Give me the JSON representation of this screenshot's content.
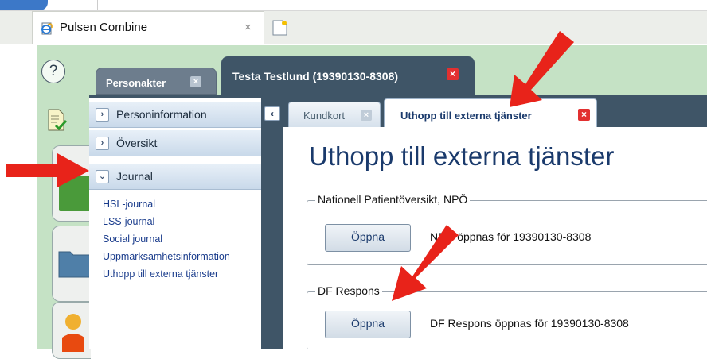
{
  "browser": {
    "tab_title": "Pulsen Combine",
    "tab_close": "×"
  },
  "app": {
    "help_symbol": "?",
    "top_tabs": [
      {
        "label": "Personakter",
        "close": "×"
      },
      {
        "label": "Testa Testlund (19390130-8308)",
        "close": "×"
      }
    ],
    "left_menu": {
      "sections": [
        {
          "label": "Personinformation",
          "chevron": "›"
        },
        {
          "label": "Översikt",
          "chevron": "›"
        },
        {
          "label": "Journal",
          "chevron": "⌄"
        }
      ],
      "journal_items": [
        "HSL-journal",
        "LSS-journal",
        "Social journal",
        "Uppmärksamhetsinformation",
        "Uthopp till externa tjänster"
      ]
    },
    "content": {
      "collapse_symbol": "‹",
      "tabs": [
        {
          "label": "Kundkort",
          "close": "×"
        },
        {
          "label": "Uthopp till externa tjänster",
          "close": "×"
        }
      ],
      "title": "Uthopp till externa tjänster",
      "groups": [
        {
          "legend": "Nationell Patientöversikt, NPÖ",
          "button": "Öppna",
          "status": "NPÖ öppnas för 19390130-8308"
        },
        {
          "legend": "DF Respons",
          "button": "Öppna",
          "status": "DF Respons öppnas för 19390130-8308"
        }
      ]
    }
  },
  "colors": {
    "app_background": "#c5e2c5",
    "dark_bar": "#3f5567",
    "arrow_red": "#e8231a",
    "title_blue": "#1a3a6c"
  }
}
